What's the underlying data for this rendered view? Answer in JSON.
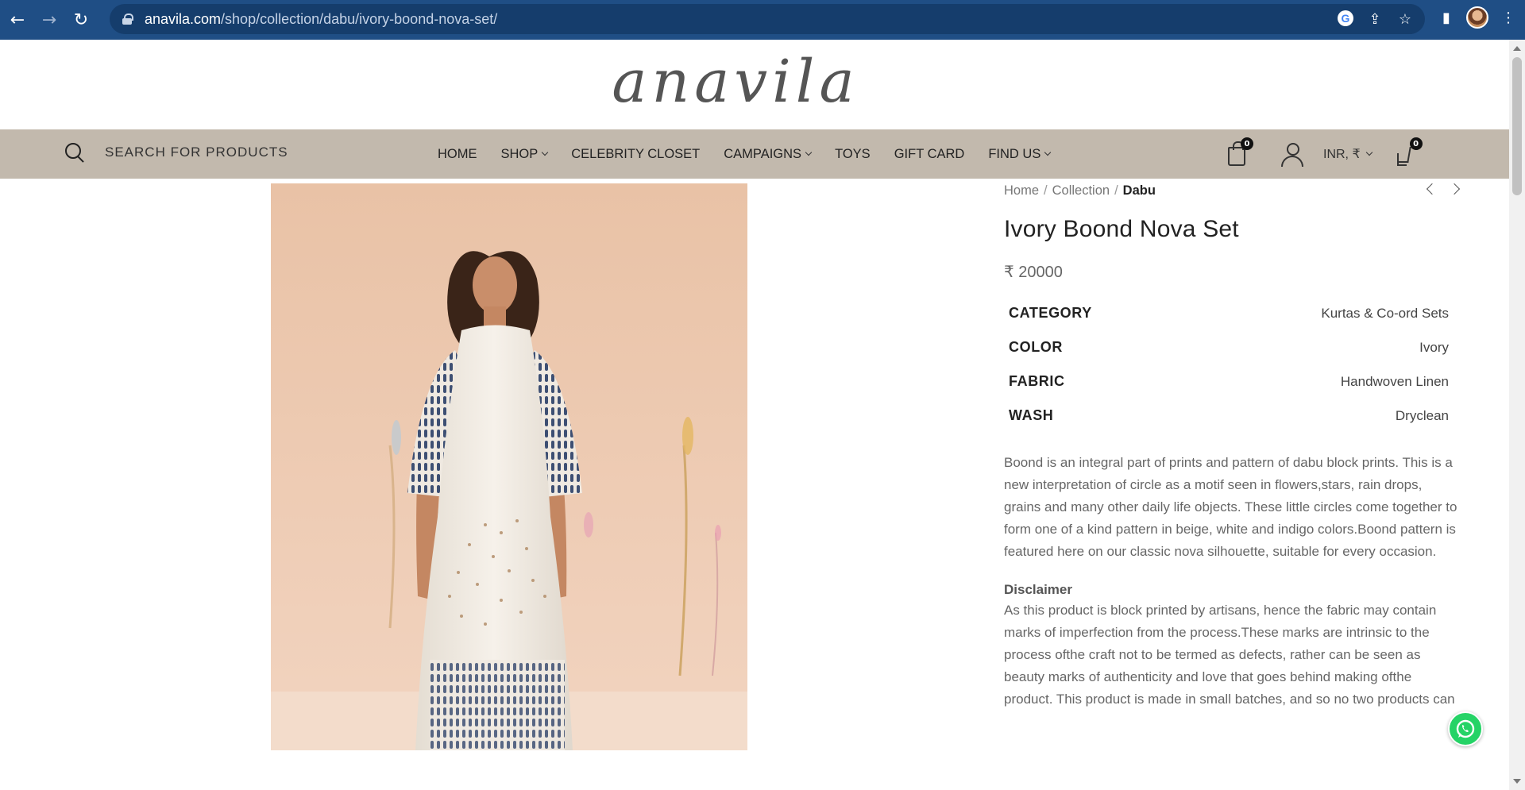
{
  "browser": {
    "url_host": "anavila.com",
    "url_path": "/shop/collection/dabu/ivory-boond-nova-set/"
  },
  "site": {
    "logo": "anavila",
    "search_placeholder": "SEARCH FOR PRODUCTS",
    "menu": [
      {
        "label": "HOME",
        "dropdown": false
      },
      {
        "label": "SHOP",
        "dropdown": true
      },
      {
        "label": "CELEBRITY CLOSET",
        "dropdown": false
      },
      {
        "label": "CAMPAIGNS",
        "dropdown": true
      },
      {
        "label": "TOYS",
        "dropdown": false
      },
      {
        "label": "GIFT CARD",
        "dropdown": false
      },
      {
        "label": "FIND US",
        "dropdown": true
      }
    ],
    "cart_count": "0",
    "currency": "INR, ₹",
    "compare_count": "0"
  },
  "product": {
    "breadcrumb": [
      "Home",
      "Collection",
      "Dabu"
    ],
    "title": "Ivory Boond Nova Set",
    "price": "₹ 20000",
    "attributes": [
      {
        "key": "CATEGORY",
        "value": "Kurtas & Co-ord Sets"
      },
      {
        "key": "COLOR",
        "value": "Ivory"
      },
      {
        "key": "FABRIC",
        "value": "Handwoven Linen"
      },
      {
        "key": "WASH",
        "value": "Dryclean"
      }
    ],
    "description": "Boond is an integral part of prints and pattern of dabu block prints. This is a new interpretation of circle as a motif seen in flowers,stars, rain drops, grains and many other daily life objects. These little circles come together to form one of a kind pattern in beige, white and indigo colors.Boond pattern is featured here on our classic nova silhouette, suitable for every occasion.",
    "disclaimer_title": "Disclaimer",
    "disclaimer": "As this product is block printed by artisans, hence the fabric may contain marks of imperfection from the process.These marks are intrinsic to the process ofthe craft not to be termed as defects, rather can be seen as beauty marks of authenticity and love that goes behind making ofthe product. This product is made in small batches, and so no two products can"
  },
  "colors": {
    "chrome": "#1f4e85",
    "nav_bg": "#c2b9ad",
    "whatsapp": "#25d366"
  }
}
